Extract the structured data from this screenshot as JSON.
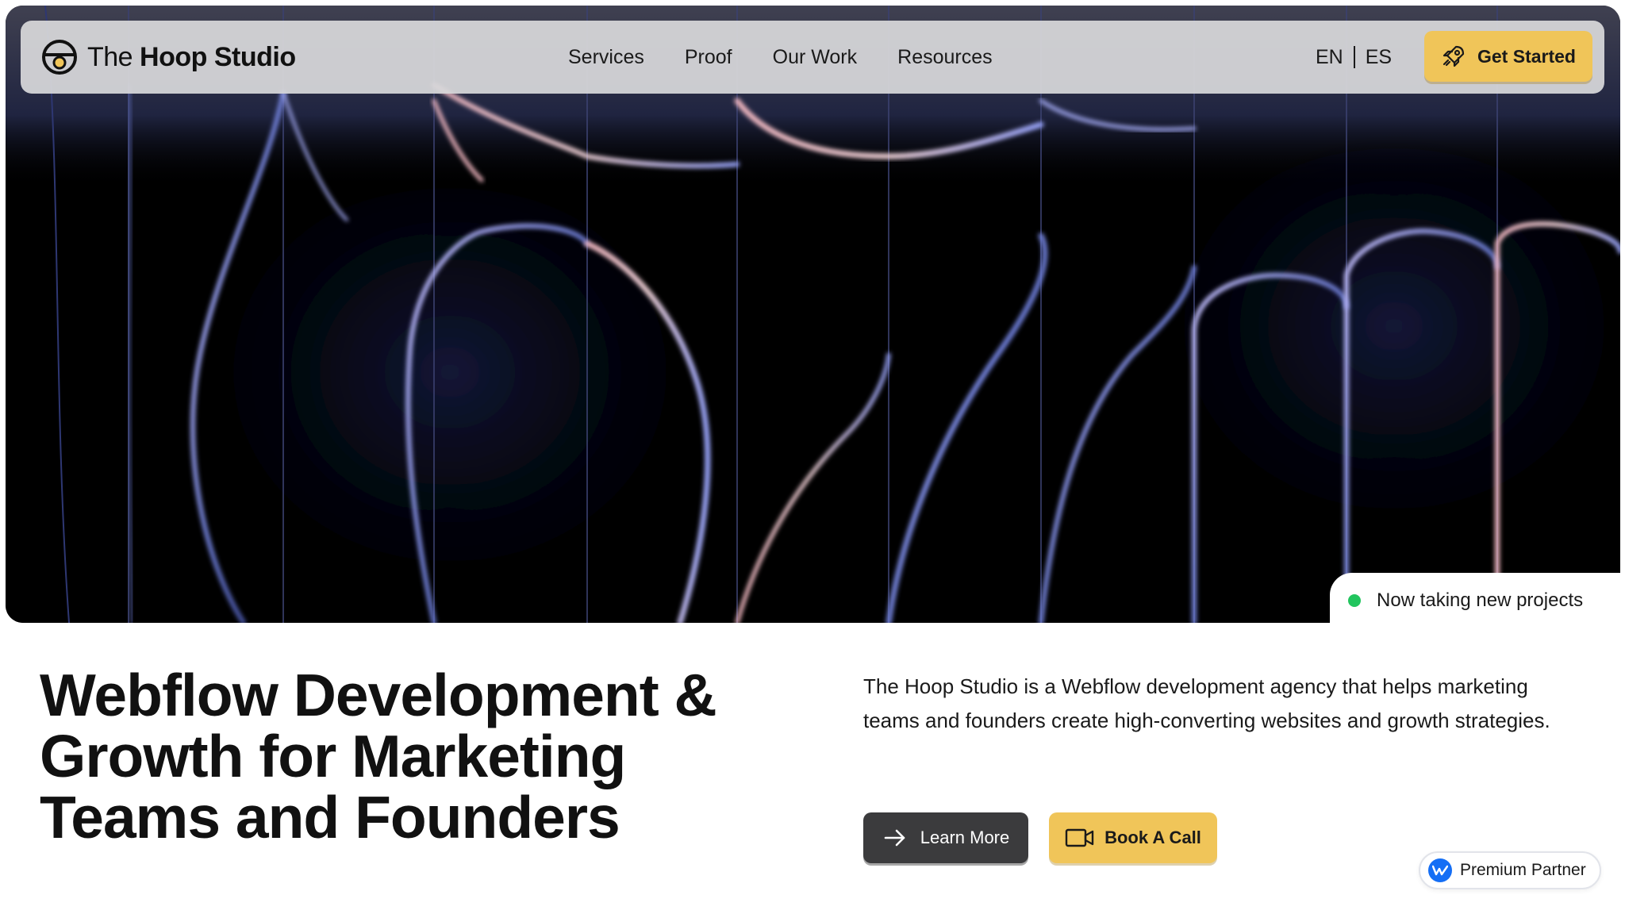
{
  "brand": {
    "name_light": "The",
    "name_bold": "Hoop Studio",
    "logo_icon": "hoop-logo-icon"
  },
  "nav": {
    "links": [
      "Services",
      "Proof",
      "Our Work",
      "Resources"
    ],
    "languages": [
      "EN",
      "ES"
    ],
    "cta_label": "Get Started",
    "cta_icon": "rocket-icon"
  },
  "hero": {
    "status_text": "Now taking new projects",
    "status_color": "#22c55e"
  },
  "main": {
    "headline": "Webflow Development & Growth for Marketing Teams and Founders",
    "description": "The Hoop Studio is a Webflow development agency that helps marketing teams and founders create high-converting websites and growth strategies.",
    "learn_more_label": "Learn More",
    "learn_more_icon": "arrow-right-icon",
    "book_call_label": "Book A Call",
    "book_call_icon": "video-camera-icon"
  },
  "badge": {
    "label": "Premium Partner",
    "icon": "webflow-icon"
  },
  "colors": {
    "accent": "#f0c559",
    "dark_button": "#3b3b3d",
    "nav_bg": "#d8d8da",
    "webflow_blue": "#146ef5"
  }
}
